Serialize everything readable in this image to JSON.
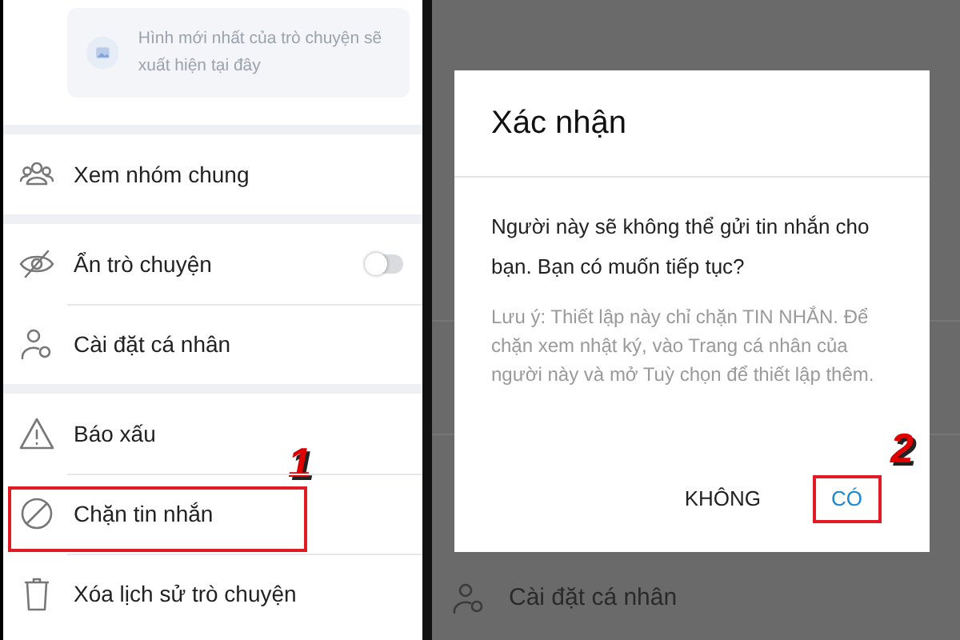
{
  "left_panel": {
    "photo_placeholder": {
      "text": "Hình mới nhất của trò chuyện sẽ xuất hiện tại đây"
    },
    "sections": [
      {
        "items": [
          {
            "kind": "link",
            "label": "Xem nhóm chung",
            "highlighted": false
          }
        ]
      },
      {
        "items": [
          {
            "kind": "toggle",
            "label": "Ẩn trò chuyện",
            "on": false,
            "highlighted": false
          },
          {
            "kind": "link",
            "label": "Cài đặt cá nhân",
            "highlighted": false
          }
        ]
      },
      {
        "items": [
          {
            "kind": "link",
            "label": "Báo xấu",
            "highlighted": false
          },
          {
            "kind": "link",
            "label": "Chặn tin nhắn",
            "highlighted": true,
            "marker": "1"
          },
          {
            "kind": "link",
            "label": "Xóa lịch sử trò chuyện",
            "highlighted": false
          }
        ]
      }
    ]
  },
  "right_panel": {
    "background_item": {
      "label": "Cài đặt cá nhân"
    },
    "dialog": {
      "title": "Xác nhận",
      "message": "Người này sẽ không thể gửi tin nhắn cho bạn. Bạn có muốn tiếp tục?",
      "note": "Lưu ý: Thiết lập này chỉ chặn TIN NHẮN. Để chặn xem nhật ký, vào Trang cá nhân của người này và mở Tuỳ chọn để thiết lập thêm.",
      "buttons": [
        {
          "label": "KHÔNG",
          "highlighted": false
        },
        {
          "label": "CÓ",
          "highlighted": true,
          "marker": "2"
        }
      ]
    }
  }
}
